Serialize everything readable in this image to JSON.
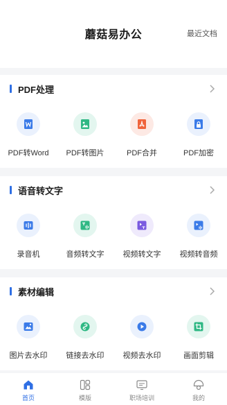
{
  "header": {
    "title": "蘑菇易办公",
    "recent_label": "最近文档"
  },
  "sections": [
    {
      "title": "PDF处理",
      "tools": [
        {
          "label": "PDF转Word",
          "icon": "pdf-to-word-icon",
          "bg": "#eaf1fd",
          "fg": "#3b7be8"
        },
        {
          "label": "PDF转图片",
          "icon": "pdf-to-image-icon",
          "bg": "#e3f6ef",
          "fg": "#2fb884"
        },
        {
          "label": "PDF合并",
          "icon": "pdf-merge-icon",
          "bg": "#fde9e4",
          "fg": "#f0643c"
        },
        {
          "label": "PDF加密",
          "icon": "pdf-encrypt-icon",
          "bg": "#eaf1fd",
          "fg": "#3b7be8"
        }
      ]
    },
    {
      "title": "语音转文字",
      "tools": [
        {
          "label": "录音机",
          "icon": "recorder-icon",
          "bg": "#eaf1fd",
          "fg": "#3b7be8"
        },
        {
          "label": "音频转文字",
          "icon": "audio-to-text-icon",
          "bg": "#e3f6ef",
          "fg": "#2fb884"
        },
        {
          "label": "视频转文字",
          "icon": "video-to-text-icon",
          "bg": "#efeafc",
          "fg": "#7a5ae0"
        },
        {
          "label": "视频转音频",
          "icon": "video-to-audio-icon",
          "bg": "#eaf1fd",
          "fg": "#3b7be8"
        }
      ]
    },
    {
      "title": "素材编辑",
      "tools": [
        {
          "label": "图片去水印",
          "icon": "image-watermark-remove-icon",
          "bg": "#eaf1fd",
          "fg": "#3b7be8"
        },
        {
          "label": "链接去水印",
          "icon": "link-watermark-remove-icon",
          "bg": "#e3f6ef",
          "fg": "#2fb884"
        },
        {
          "label": "视频去水印",
          "icon": "video-watermark-remove-icon",
          "bg": "#eaf1fd",
          "fg": "#3b7be8"
        },
        {
          "label": "画面剪辑",
          "icon": "crop-icon",
          "bg": "#e3f6ef",
          "fg": "#2fb884"
        }
      ]
    }
  ],
  "tabbar": {
    "active_color": "#2f6fe4",
    "items": [
      {
        "label": "首页",
        "icon": "home-icon"
      },
      {
        "label": "模版",
        "icon": "template-icon"
      },
      {
        "label": "职场培训",
        "icon": "training-icon"
      },
      {
        "label": "我的",
        "icon": "profile-icon"
      }
    ]
  }
}
